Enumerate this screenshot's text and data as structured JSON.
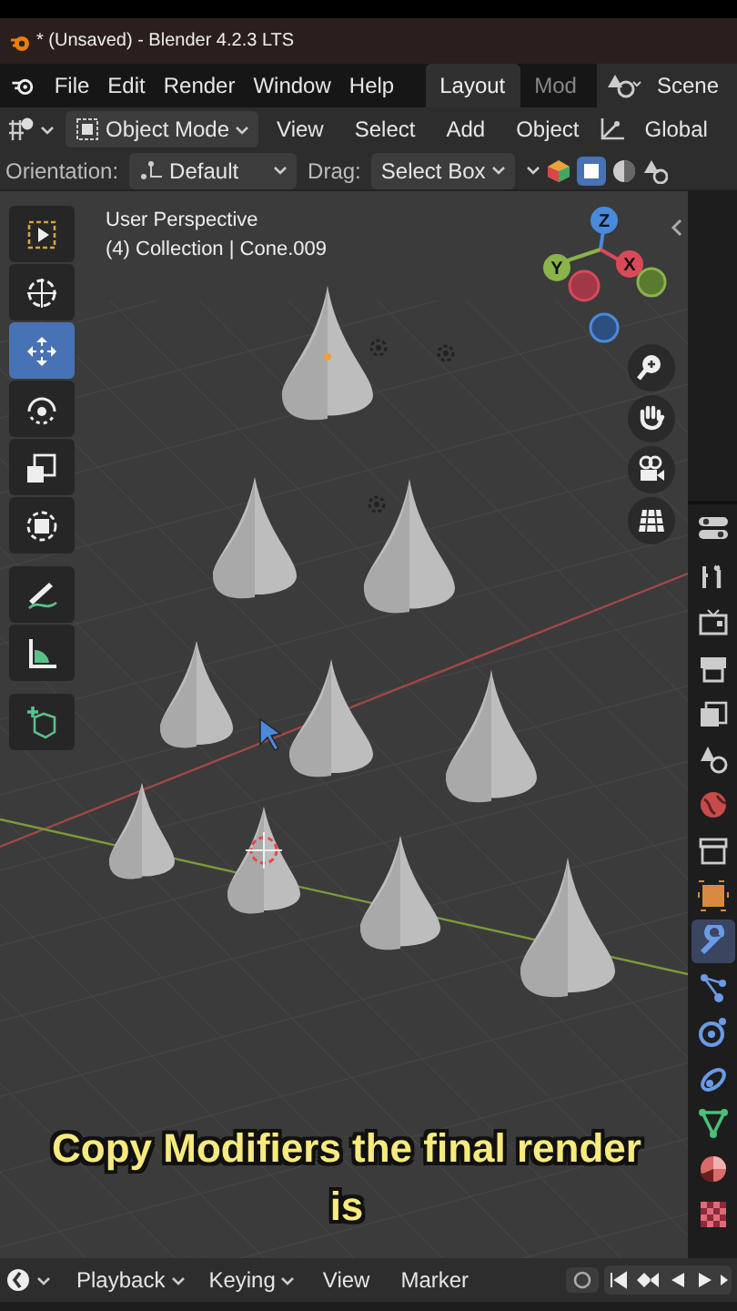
{
  "title_bar": {
    "title": "* (Unsaved) - Blender 4.2.3 LTS"
  },
  "menu": [
    "File",
    "Edit",
    "Render",
    "Window",
    "Help"
  ],
  "workspace_tabs": [
    {
      "label": "Layout",
      "selected": true
    },
    {
      "label": "Mod",
      "selected": false
    }
  ],
  "scene": "Scene",
  "header": {
    "mode": "Object Mode",
    "menus": [
      "View",
      "Select",
      "Add",
      "Object"
    ],
    "transform": "Global"
  },
  "tool_settings": {
    "orientation_label": "Orientation:",
    "orientation": "Default",
    "drag_label": "Drag:",
    "drag": "Select Box"
  },
  "toolbar": [
    {
      "kind": "select",
      "selected": false
    },
    {
      "kind": "cursor",
      "selected": false
    },
    {
      "kind": "move",
      "selected": true
    },
    {
      "kind": "rotate",
      "selected": false
    },
    {
      "kind": "scale",
      "selected": false
    },
    {
      "kind": "transform",
      "selected": false
    },
    {
      "kind": "annotate",
      "selected": false
    },
    {
      "kind": "measure",
      "selected": false
    },
    {
      "kind": "add",
      "selected": false
    }
  ],
  "viewport": {
    "perspective": "User Perspective",
    "collection": "(4) Collection | Cone.009"
  },
  "gizmo": {
    "z": "Z",
    "y": "Y",
    "x": "X"
  },
  "properties_tabs": [
    {
      "kind": "tool",
      "selected": false
    },
    {
      "kind": "render",
      "selected": false
    },
    {
      "kind": "output",
      "selected": false
    },
    {
      "kind": "view",
      "selected": false
    },
    {
      "kind": "scene",
      "selected": false
    },
    {
      "kind": "world",
      "selected": false
    },
    {
      "kind": "collection",
      "selected": false
    },
    {
      "kind": "object",
      "selected": false
    },
    {
      "kind": "modifiers",
      "selected": true
    },
    {
      "kind": "particles",
      "selected": false
    },
    {
      "kind": "physics",
      "selected": false
    },
    {
      "kind": "constraints",
      "selected": false
    },
    {
      "kind": "data",
      "selected": false
    },
    {
      "kind": "material",
      "selected": false
    },
    {
      "kind": "texture",
      "selected": false
    }
  ],
  "caption": "Copy Modifiers the final render is",
  "timeline": {
    "menus": [
      {
        "label": "Playback",
        "dropdown": true
      },
      {
        "label": "Keying",
        "dropdown": true
      },
      {
        "label": "View",
        "dropdown": false
      },
      {
        "label": "Marker",
        "dropdown": false
      }
    ]
  }
}
